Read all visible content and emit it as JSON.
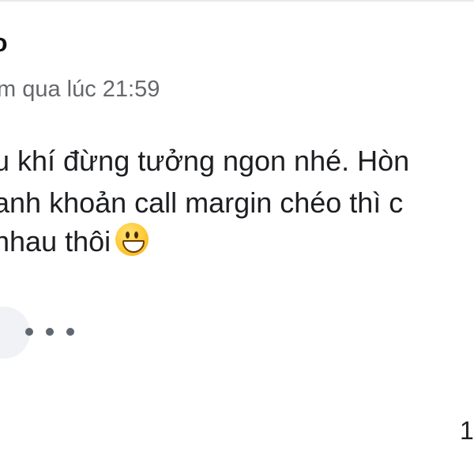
{
  "comment": {
    "author": "o",
    "timestamp": "m qua lúc 21:59",
    "lines": [
      "u khí đừng tưởng ngon nhé. Hòn",
      "anh khoản call margin chéo thì c",
      "nhau thôi"
    ],
    "emoji": "grinning-face",
    "reaction_count": "1"
  },
  "icons": {
    "more": "more-horizontal-icon",
    "emoji": "grinning-face-icon"
  },
  "colors": {
    "background": "#ffffff",
    "text": "#1c1e21",
    "secondary_text": "#65676b",
    "dots": "#606770",
    "avatar_bg": "#f0f2f5",
    "emoji_yellow": "#ffc933"
  }
}
